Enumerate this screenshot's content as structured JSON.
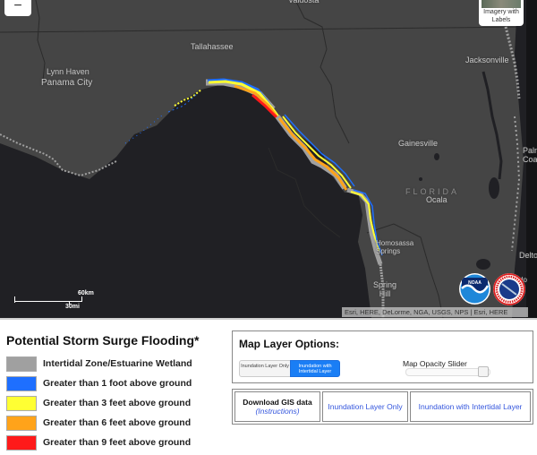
{
  "map": {
    "controls": {
      "zoom_out_label": "−",
      "basemap_toggle_label": "Imagery with Labels"
    },
    "labels": {
      "tallahassee": "Tallahassee",
      "lynn_haven": "Lynn Haven",
      "panama_city": "Panama City",
      "jacksonville": "Jacksonville",
      "gainesville": "Gainesville",
      "florida": "FLORIDA",
      "ocala": "Ocala",
      "homosassa_springs": "Homosassa Springs",
      "spring_hill": "Spring Hill",
      "palm_coast": "Palm Coast",
      "deltona": "Delto",
      "orlando_partial": "do",
      "valdosta_partial": "Valdosta"
    },
    "scalebar": {
      "km": "60km",
      "mi": "30mi"
    },
    "attribution": "Esri, HERE, DeLorme, NGA, USGS, NPS | Esri, HERE",
    "logos": {
      "noaa": "noaa-logo",
      "nws": "nws-logo"
    },
    "colors": {
      "land": "#454545",
      "water": "#202024",
      "intertidal": "#a0a0a0",
      "gt1": "#1e6fff",
      "gt3": "#ffff33",
      "gt6": "#ffa31a",
      "gt9": "#ff1a1a"
    }
  },
  "legend": {
    "title": "Potential Storm Surge Flooding*",
    "items": [
      {
        "label": "Intertidal Zone/Estuarine Wetland",
        "color": "#a0a0a0"
      },
      {
        "label": "Greater than 1 foot above ground",
        "color": "#1e6fff"
      },
      {
        "label": "Greater than 3 feet above ground",
        "color": "#ffff33"
      },
      {
        "label": "Greater than 6 feet above ground",
        "color": "#ffa31a"
      },
      {
        "label": "Greater than 9 feet above ground",
        "color": "#ff1a1a"
      }
    ]
  },
  "layer_options": {
    "title": "Map Layer Options:",
    "toggle": {
      "options": [
        "Inundation Layer Only",
        "Inundation with Intertidal Layer"
      ],
      "selected": "Inundation with Intertidal Layer"
    },
    "opacity_slider": {
      "label": "Map Opacity Slider",
      "value_fraction": 0.97
    }
  },
  "downloads": {
    "title": "Download GIS data",
    "instructions": "(Instructions)",
    "links": [
      "Inundation Layer Only",
      "Inundation with Intertidal Layer"
    ]
  }
}
